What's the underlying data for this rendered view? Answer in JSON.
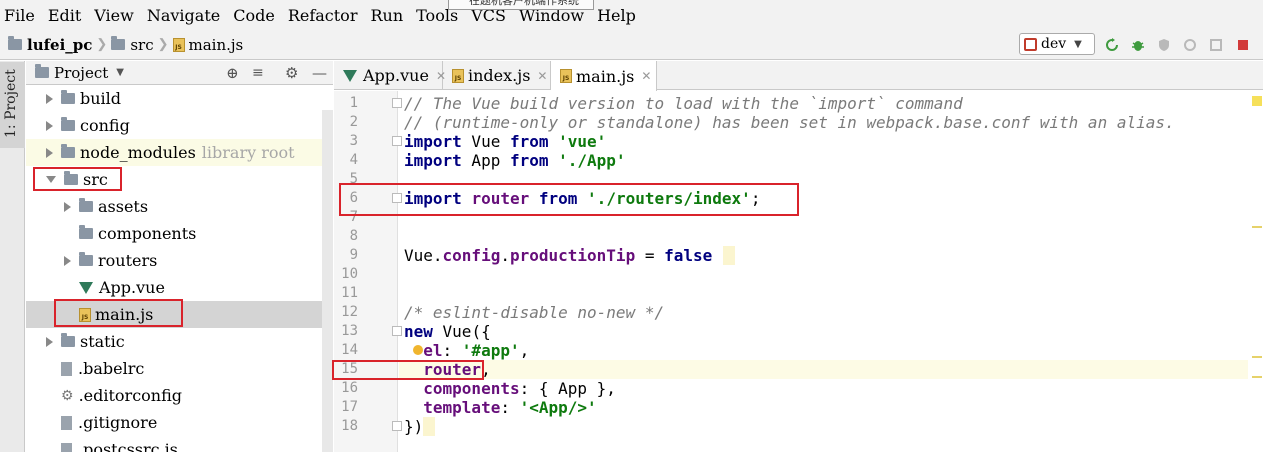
{
  "menu": [
    "File",
    "Edit",
    "View",
    "Navigate",
    "Code",
    "Refactor",
    "Run",
    "Tools",
    "VCS",
    "Window",
    "Help"
  ],
  "tooltip_text": "在题机客户机端作系统",
  "breadcrumb": {
    "project": "lufei_pc",
    "folder": "src",
    "file": "main.js"
  },
  "run_config": {
    "label": "dev"
  },
  "project_panel": {
    "title": "Project"
  },
  "side_tab": "1: Project",
  "tree": [
    {
      "label": "build",
      "type": "folder",
      "level": 0,
      "expanded": false
    },
    {
      "label": "config",
      "type": "folder",
      "level": 0,
      "expanded": false
    },
    {
      "label": "node_modules",
      "suffix": "library root",
      "type": "folder",
      "level": 0,
      "expanded": false
    },
    {
      "label": "src",
      "type": "folder",
      "level": 0,
      "expanded": true
    },
    {
      "label": "assets",
      "type": "folder",
      "level": 1,
      "expanded": false
    },
    {
      "label": "components",
      "type": "folder",
      "level": 1
    },
    {
      "label": "routers",
      "type": "folder",
      "level": 1,
      "expanded": false
    },
    {
      "label": "App.vue",
      "type": "vue",
      "level": 1
    },
    {
      "label": "main.js",
      "type": "js",
      "level": 1
    },
    {
      "label": "static",
      "type": "folder",
      "level": 0,
      "expanded": false
    },
    {
      "label": ".babelrc",
      "type": "file",
      "level": 0
    },
    {
      "label": ".editorconfig",
      "type": "gear",
      "level": 0
    },
    {
      "label": ".gitignore",
      "type": "file",
      "level": 0
    },
    {
      "label": ".postcssrc.js",
      "type": "file",
      "level": 0
    }
  ],
  "tabs": [
    {
      "label": "App.vue",
      "type": "vue"
    },
    {
      "label": "index.js",
      "type": "js"
    },
    {
      "label": "main.js",
      "type": "js",
      "active": true
    }
  ],
  "code_lines": [
    {
      "n": "1",
      "text": "// The Vue build version to load with the `import` command"
    },
    {
      "n": "2",
      "text": "// (runtime-only or standalone) has been set in webpack.base.conf with an alias."
    },
    {
      "n": "3",
      "text": "import Vue from 'vue'"
    },
    {
      "n": "4",
      "text": "import App from './App'"
    },
    {
      "n": "5",
      "text": ""
    },
    {
      "n": "6",
      "text": "import router from './routers/index';"
    },
    {
      "n": "7",
      "text": ""
    },
    {
      "n": "8",
      "text": ""
    },
    {
      "n": "9",
      "text": "Vue.config.productionTip = false"
    },
    {
      "n": "10",
      "text": ""
    },
    {
      "n": "11",
      "text": ""
    },
    {
      "n": "12",
      "text": "/* eslint-disable no-new */"
    },
    {
      "n": "13",
      "text": "new Vue({"
    },
    {
      "n": "14",
      "text": "  el: '#app',"
    },
    {
      "n": "15",
      "text": "  router,"
    },
    {
      "n": "16",
      "text": "  components: { App },"
    },
    {
      "n": "17",
      "text": "  template: '<App/>'"
    },
    {
      "n": "18",
      "text": "})"
    }
  ],
  "colors": {
    "highlight_box": "#d9232b",
    "keyword": "#00007f",
    "string": "#0e7a0e",
    "comment": "#7a7a7a",
    "property": "#660e7a"
  }
}
